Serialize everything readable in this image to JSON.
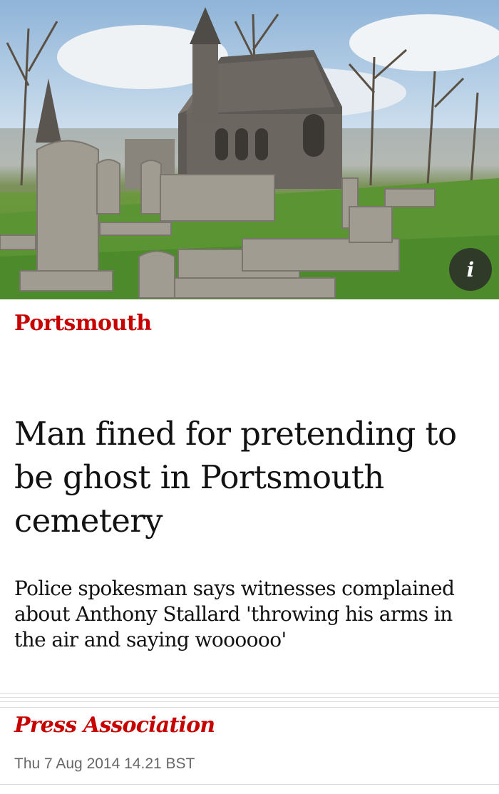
{
  "article": {
    "section": "Portsmouth",
    "headline": "Man fined for pretending to be ghost in Portsmouth cemetery",
    "standfirst": "Police spokesman says witnesses complained about Anthony Stallard 'throwing his arms in the air and saying woooooo'",
    "byline": "Press Association",
    "date": "Thu 7 Aug 2014 14.21 BST"
  },
  "hero": {
    "info_button_label": "i",
    "image_subject": "cemetery-chapel-photo"
  },
  "colors": {
    "accent": "#c70000",
    "text": "#121212",
    "meta": "#666666"
  }
}
